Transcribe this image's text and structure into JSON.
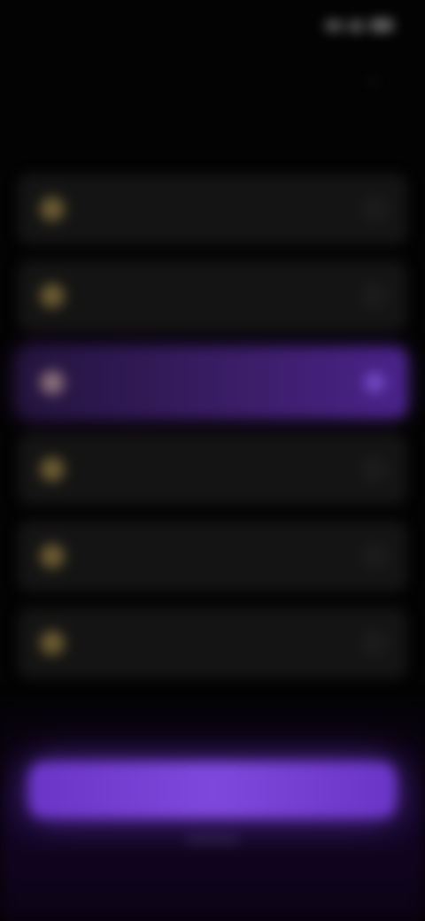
{
  "status_bar": {
    "time": "",
    "icons": [
      "signal-icon",
      "wifi-icon",
      "battery-icon"
    ]
  },
  "header": {
    "section_title": "",
    "close_icon": "close-icon"
  },
  "options": [
    {
      "label": "",
      "icon": "coin-icon",
      "selected": false
    },
    {
      "label": "",
      "icon": "coin-icon",
      "selected": false
    },
    {
      "label": "",
      "icon": "coin-icon",
      "selected": true
    },
    {
      "label": "",
      "icon": "coin-icon",
      "selected": false
    },
    {
      "label": "",
      "icon": "coin-icon",
      "selected": false
    },
    {
      "label": "",
      "icon": "coin-icon",
      "selected": false
    }
  ],
  "footer": {
    "primary_button_label": ""
  },
  "colors": {
    "background": "#030303",
    "row_background": "#141414",
    "accent": "#7f48dc",
    "selected_row": "#3a1d66"
  }
}
